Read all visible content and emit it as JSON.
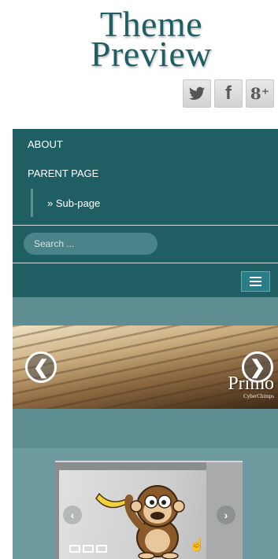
{
  "header": {
    "title_line1": "Theme",
    "title_line2": "Preview"
  },
  "social": [
    {
      "name": "twitter",
      "glyph": "🐦"
    },
    {
      "name": "facebook",
      "glyph": "f"
    },
    {
      "name": "google-plus",
      "glyph": "8⁺"
    }
  ],
  "nav": {
    "items": [
      {
        "label": "ABOUT"
      },
      {
        "label": "PARENT PAGE"
      }
    ],
    "sub_item": "» Sub-page",
    "search_placeholder": "Search ...",
    "menu_toggle_icon": "hamburger-icon"
  },
  "slider": {
    "prev_glyph": "❮",
    "next_glyph": "❯",
    "brand": "Primo",
    "brand_sub": "CyberChimps"
  },
  "showcase": {
    "prev_glyph": "‹",
    "next_glyph": "›",
    "cursor_glyph": "☝"
  },
  "colors": {
    "nav_bg": "#1f5e63",
    "band_bg": "#5f8e92",
    "lower_bg": "#6d9a9e",
    "logo_text": "#1f5e63"
  }
}
